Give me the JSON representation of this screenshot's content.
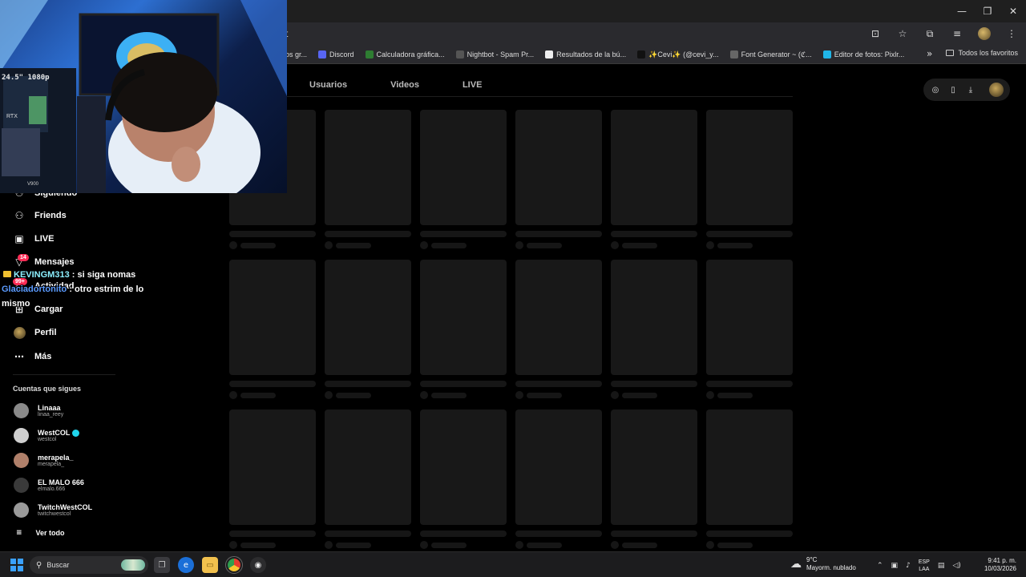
{
  "window": {
    "minimize": "—",
    "restore": "❐",
    "close": "✕"
  },
  "addressbar": {
    "url": "t"
  },
  "bookmarks": {
    "items": [
      {
        "label": "os gr...",
        "color": "#666666"
      },
      {
        "label": "Discord",
        "color": "#5865f2"
      },
      {
        "label": "Calculadora gráfica...",
        "color": "#2e7d32"
      },
      {
        "label": "Nightbot - Spam Pr...",
        "color": "#555555"
      },
      {
        "label": "Resultados de la bú...",
        "color": "#eeeeee"
      },
      {
        "label": "✨Cevi✨ (@cevi_y...",
        "color": "#111111"
      },
      {
        "label": "Font Generator ~ (ℭ...",
        "color": "#666666"
      },
      {
        "label": "Editor de fotos: Pixlr...",
        "color": "#20b6e8"
      }
    ],
    "more": "»",
    "all_favorites": "Todos los favoritos"
  },
  "tabs": [
    {
      "label": "Usuarios"
    },
    {
      "label": "Videos"
    },
    {
      "label": "LIVE"
    }
  ],
  "sidebar": {
    "following_partial": "Siguiendo",
    "nav": [
      {
        "label": "Friends",
        "icon": "friends-icon"
      },
      {
        "label": "LIVE",
        "icon": "live-icon"
      },
      {
        "label": "Mensajes",
        "icon": "messages-icon",
        "badge": "14"
      },
      {
        "label": "Actividad",
        "icon": "activity-icon",
        "badge": "99+"
      },
      {
        "label": "Cargar",
        "icon": "upload-icon"
      },
      {
        "label": "Perfil",
        "icon": "profile-icon"
      },
      {
        "label": "Más",
        "icon": "more-icon"
      }
    ],
    "following_title": "Cuentas que sigues",
    "accounts": [
      {
        "name": "Linaaa",
        "user": "linaa_reey",
        "verified": false,
        "color": "#8a8a8a"
      },
      {
        "name": "WestCOL",
        "user": "westcol",
        "verified": true,
        "color": "#cfcfcf"
      },
      {
        "name": "merapela_",
        "user": "merapela_",
        "verified": false,
        "color": "#b0806a"
      },
      {
        "name": "EL MALO 666",
        "user": "elmalo.666",
        "verified": false,
        "color": "#3a3a3a"
      },
      {
        "name": "TwitchWestCOL",
        "user": "twitchwestcol",
        "verified": false,
        "color": "#9a9a9a"
      }
    ],
    "see_all": "Ver todo"
  },
  "chat": {
    "messages": [
      {
        "user": "KEVINGM313",
        "text": " : si siga nomas"
      },
      {
        "user": "Glaciadortonito",
        "text": " : otro estrim de lo mismo"
      }
    ]
  },
  "webcam": {
    "monitor_label": "24.5\" 1080p",
    "gpu_label": "RTX",
    "case_label": "V900"
  },
  "taskbar": {
    "search_placeholder": "Buscar",
    "weather_temp": "9°C",
    "weather_desc": "Mayorm. nublado",
    "lang_1": "ESP",
    "lang_2": "LAA",
    "time": "9:41 p. m.",
    "date": "10/03/2026"
  }
}
